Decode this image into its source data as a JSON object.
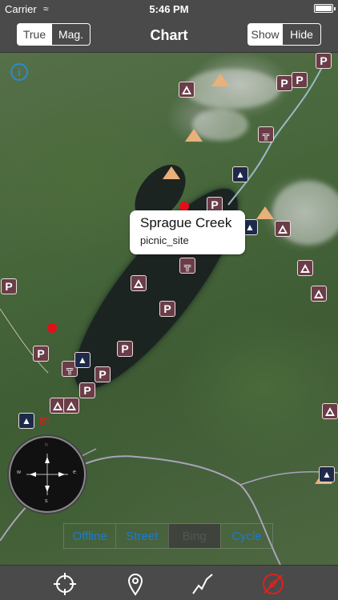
{
  "status": {
    "carrier": "Carrier",
    "time": "5:46 PM"
  },
  "nav": {
    "title": "Chart",
    "north": {
      "options": [
        "True",
        "Mag."
      ],
      "selected": "True"
    },
    "labels": {
      "options": [
        "Show",
        "Hide"
      ],
      "selected": "Show"
    }
  },
  "callout": {
    "name": "Sprague Creek",
    "type": "picnic_site"
  },
  "compass": {
    "n": "n",
    "s": "s",
    "e": "e",
    "w": "w"
  },
  "map_tabs": {
    "options": [
      "Offline",
      "Street",
      "Bing",
      "Cycle"
    ],
    "selected": "Bing"
  },
  "map_label_red": "8°",
  "tabbar": {
    "items": [
      "locate-icon",
      "pin-icon",
      "route-icon",
      "compass-off-icon"
    ],
    "accent": "#e0201a"
  },
  "colors": {
    "link": "#1a7ad6",
    "marker": "#6a3d48",
    "peak": "#e8b07a",
    "pin": "#e0101a"
  }
}
